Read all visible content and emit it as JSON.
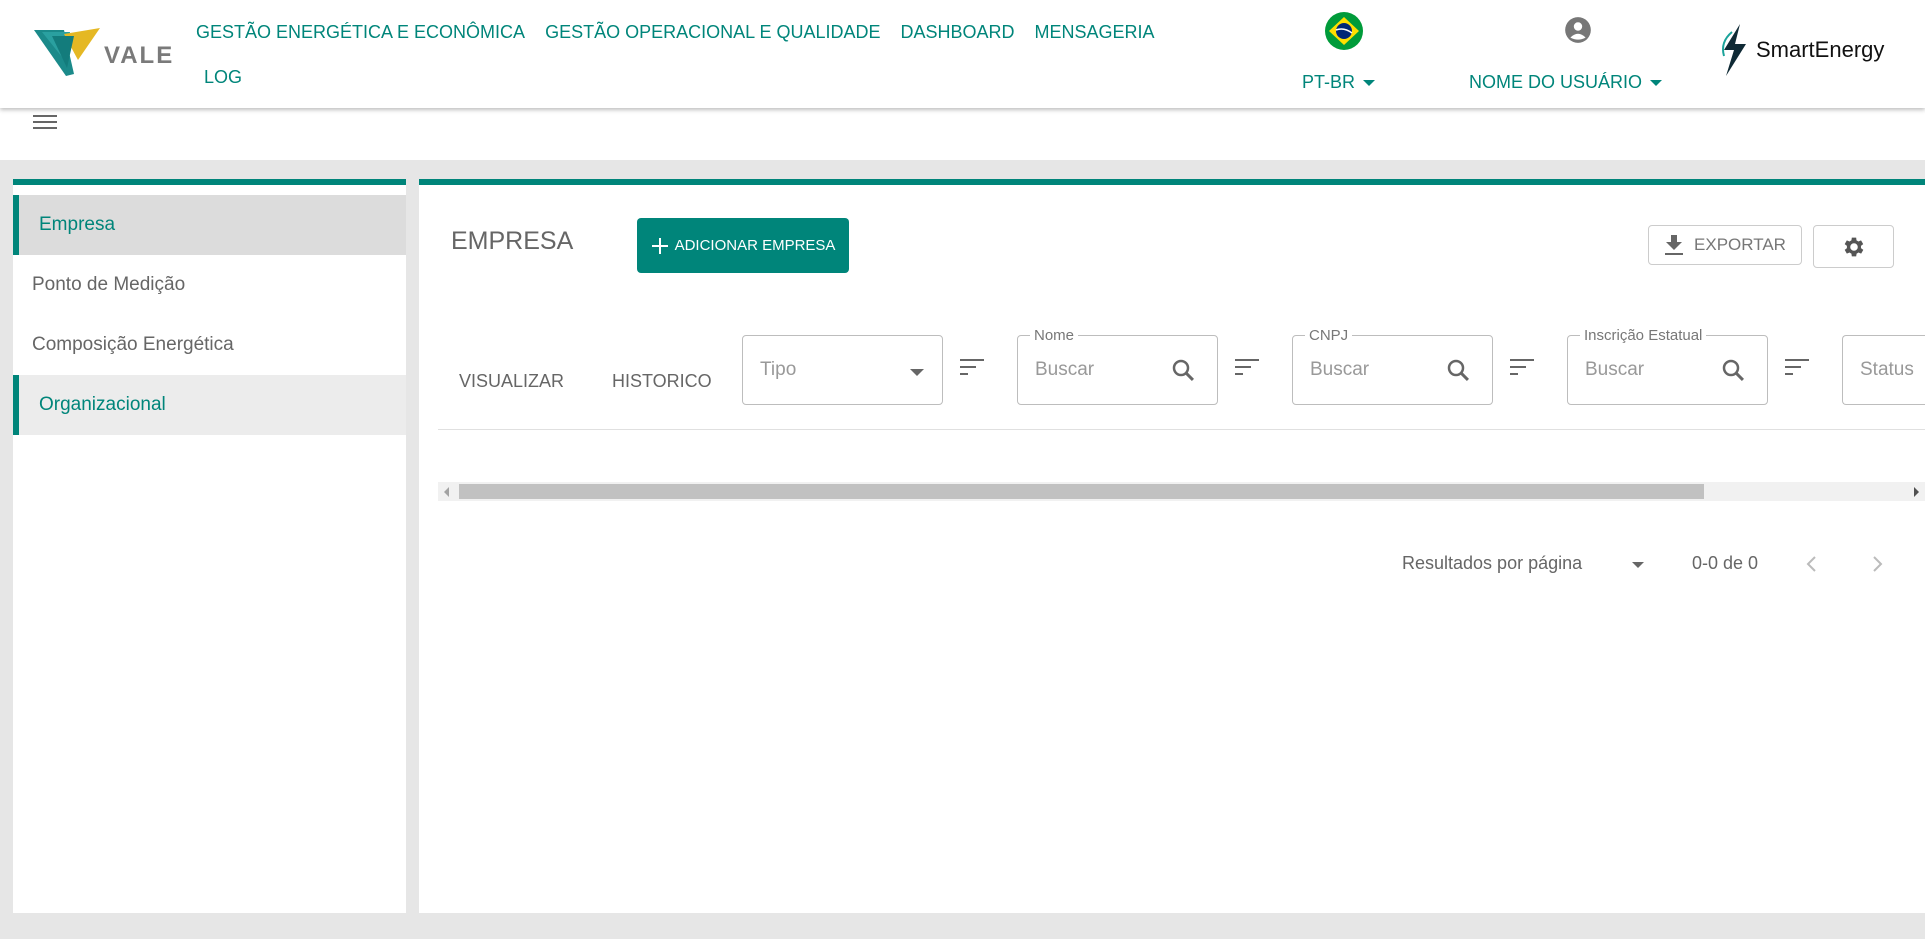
{
  "header": {
    "logo_text": "VALE",
    "nav": [
      "GESTÃO ENERGÉTICA E ECONÔMICA",
      "GESTÃO OPERACIONAL E QUALIDADE",
      "DASHBOARD",
      "MENSAGERIA",
      "LOG"
    ],
    "language": "PT-BR",
    "user_name": "NOME DO USUÁRIO",
    "brand_text": "SmartEnergy"
  },
  "sidebar": {
    "items": [
      "Empresa",
      "Ponto de Medição",
      "Composição Energética",
      "Organizacional"
    ]
  },
  "main": {
    "title": "EMPRESA",
    "add_label": "ADICIONAR EMPRESA",
    "export_label": "EXPORTAR",
    "columns": {
      "visualizar": "VISUALIZAR",
      "historico": "HISTORICO"
    },
    "filters": {
      "tipo_placeholder": "Tipo",
      "nome_legend": "Nome",
      "cnpj_legend": "CNPJ",
      "ie_legend": "Inscrição Estatual",
      "search_placeholder": "Buscar",
      "status_placeholder": "Status"
    },
    "pager": {
      "label": "Resultados por página",
      "range": "0-0 de 0"
    }
  },
  "colors": {
    "accent": "#00857a",
    "background": "#e6e6e6"
  }
}
